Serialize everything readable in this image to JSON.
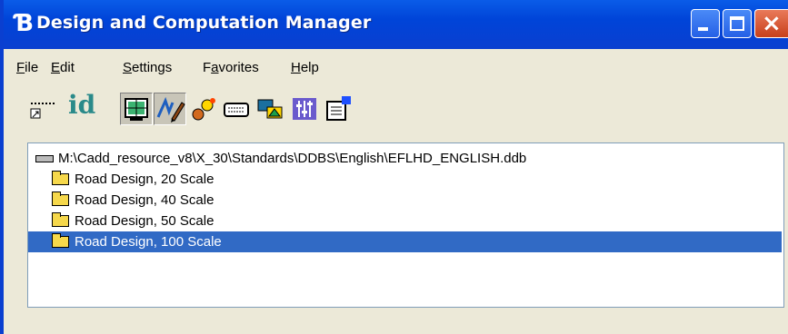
{
  "window": {
    "title": "Design and Computation Manager",
    "title_icon": "bentley-b-icon"
  },
  "colors": {
    "titlebar": "#0a3fd0",
    "selection": "#316ac5",
    "chrome": "#ece9d8"
  },
  "menu": {
    "file": {
      "acc": "F",
      "rest": "ile"
    },
    "edit": {
      "acc": "E",
      "rest": "dit"
    },
    "settings": {
      "acc": "S",
      "rest": "ettings"
    },
    "favorites": {
      "pre": "F",
      "acc": "a",
      "rest": "vorites"
    },
    "help": {
      "acc": "H",
      "rest": "elp"
    }
  },
  "toolbar": {
    "id_label": "id",
    "tools": [
      "place-line-icon",
      "id-icon",
      "design-mode-icon",
      "draw-mode-icon",
      "search-icon",
      "keyboard-icon",
      "user-computer-icon",
      "settings-icon",
      "properties-icon"
    ]
  },
  "tree": {
    "root_path": "M:\\Cadd_resource_v8\\X_30\\Standards\\DDBS\\English\\EFLHD_ENGLISH.ddb",
    "items": [
      {
        "label": "Road Design,  20 Scale",
        "selected": false
      },
      {
        "label": "Road Design,  40 Scale",
        "selected": false
      },
      {
        "label": "Road Design,  50 Scale",
        "selected": false
      },
      {
        "label": "Road Design,  100 Scale",
        "selected": true
      }
    ]
  }
}
